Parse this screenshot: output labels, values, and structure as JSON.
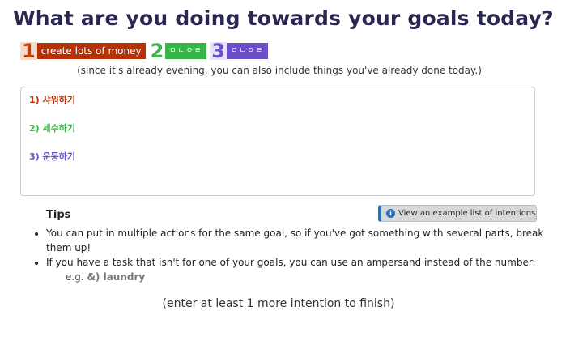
{
  "title": "What are you doing towards your goals today?",
  "goals": [
    {
      "number": "1",
      "label": "create lots of money"
    },
    {
      "number": "2",
      "label": "ㅁㄴㅇㄹ"
    },
    {
      "number": "3",
      "label": "ㅁㄴㅇㄹ"
    }
  ],
  "note": "(since it's already evening, you can also include things you've already done today.)",
  "intentions": [
    "1) 샤워하기",
    "2) 세수하기",
    "3) 운동하기"
  ],
  "example_button": {
    "icon": "info-icon",
    "label": "View an example list of intentions"
  },
  "tips": {
    "title": "Tips",
    "items": [
      "You can put in multiple actions for the same goal, so if you've got something with several parts, break them up!",
      "If you have a task that isn't for one of your goals, you can use an ampersand instead of the number:"
    ],
    "example_prefix": "e.g.",
    "example_code": "&) laundry"
  },
  "finish_text": "(enter at least 1 more intention to finish)",
  "colors": {
    "goal1": "#b83006",
    "goal2": "#38b449",
    "goal3": "#6a4fc7",
    "title": "#2a2750"
  }
}
